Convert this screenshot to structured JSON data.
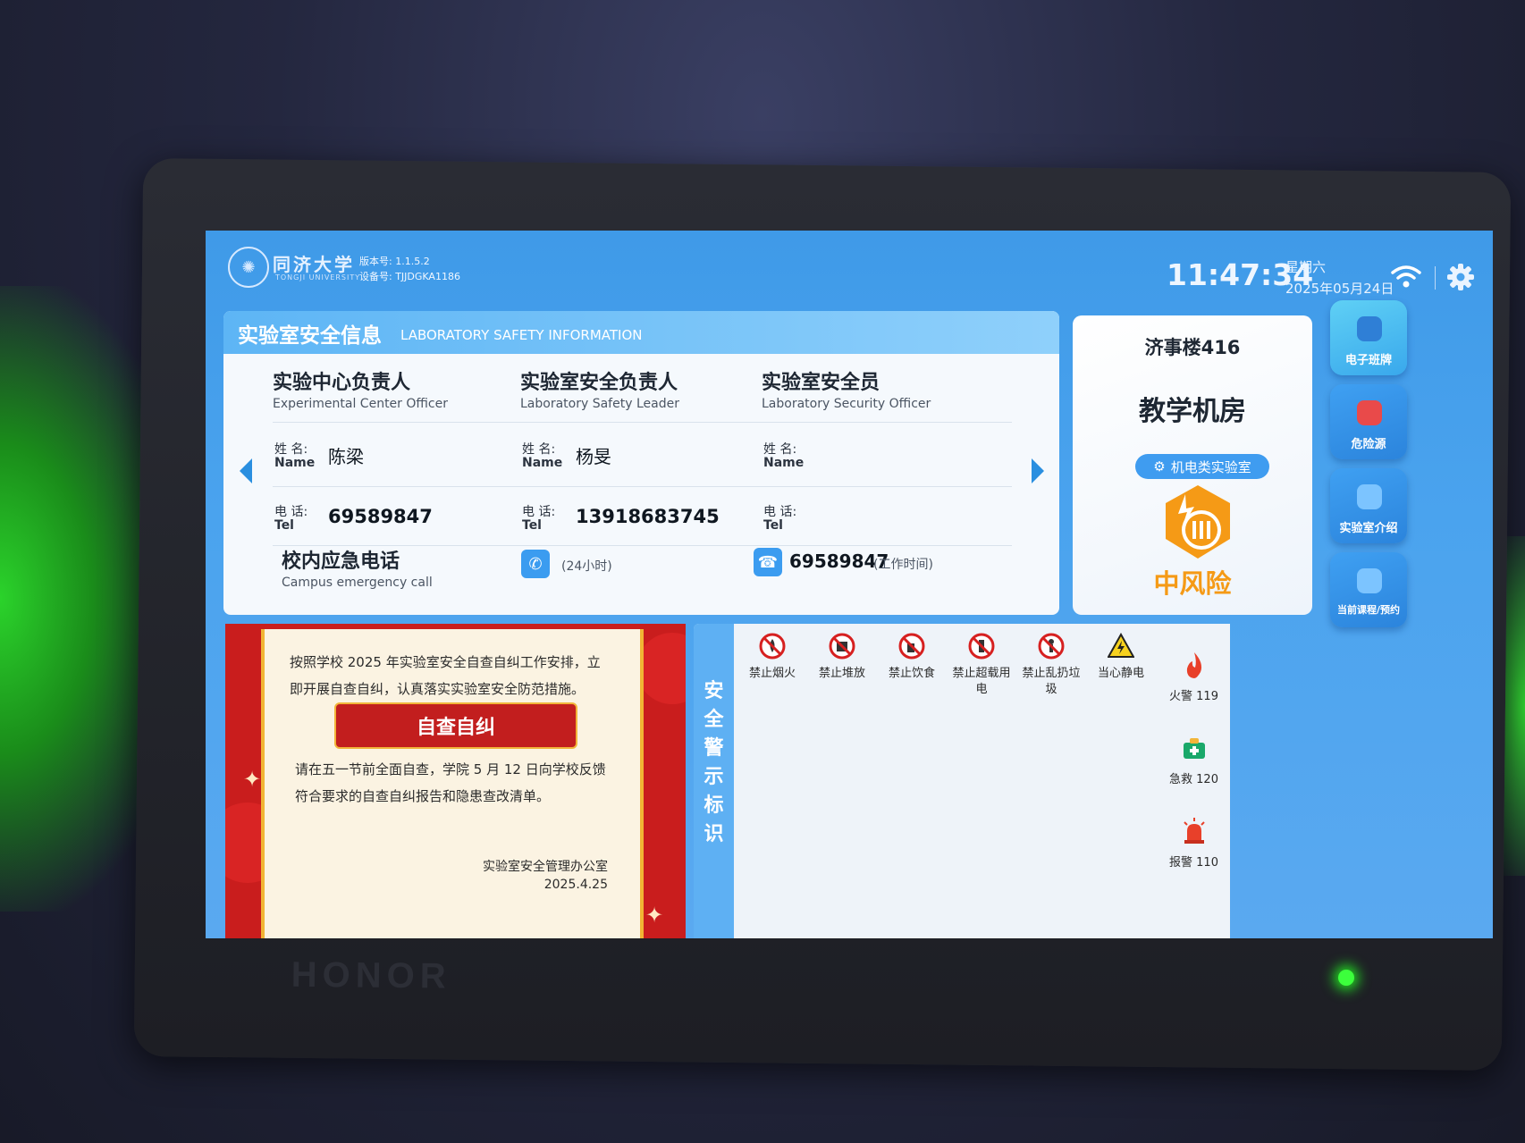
{
  "header": {
    "university_name": "同济大学",
    "university_sub": "TONGJI UNIVERSITY",
    "version_label": "版本号: 1.1.5.2",
    "device_label": "设备号: TJJDGKA1186",
    "time": "11:47:34",
    "weekday": "星期六",
    "date": "2025年05月24日"
  },
  "safety_info": {
    "title_cn": "实验室安全信息",
    "title_en": "LABORATORY SAFETY INFORMATION",
    "name_label_cn": "姓 名:",
    "name_label_en": "Name",
    "tel_label_cn": "电 话:",
    "tel_label_en": "Tel",
    "officers": [
      {
        "role_cn": "实验中心负责人",
        "role_en": "Experimental Center Officer",
        "name": "陈梁",
        "tel": "69589847"
      },
      {
        "role_cn": "实验室安全负责人",
        "role_en": "Laboratory Safety Leader",
        "name": "杨旻",
        "tel": "13918683745"
      },
      {
        "role_cn": "实验室安全员",
        "role_en": "Laboratory Security Officer",
        "name": "",
        "tel": ""
      }
    ],
    "emergency": {
      "title_cn": "校内应急电话",
      "title_en": "Campus emergency call",
      "hours_24": "(24小时)",
      "number": "69589847",
      "work_hours": "(工作时间)"
    }
  },
  "room": {
    "number": "济事楼416",
    "name": "教学机房",
    "category": "机电类实验室",
    "risk_level": "中风险",
    "risk_color": "#f59a16"
  },
  "side_nav": [
    {
      "label": "电子班牌",
      "icon": "monitor-icon"
    },
    {
      "label": "危险源",
      "icon": "warning-icon"
    },
    {
      "label": "实验室介绍",
      "icon": "flask-icon"
    },
    {
      "label": "当前课程/预约",
      "icon": "calendar-icon"
    }
  ],
  "notice": {
    "paragraph1": "按照学校 2025 年实验室安全自查自纠工作安排，立即开展自查自纠，认真落实实验室安全防范措施。",
    "button": "自查自纠",
    "paragraph2": "请在五一节前全面自查，学院 5 月 12 日向学校反馈符合要求的自查自纠报告和隐患查改清单。",
    "signature": "实验室安全管理办公室",
    "sign_date": "2025.4.25"
  },
  "warnings": {
    "title": "安全警示标识",
    "signs": [
      {
        "label": "禁止烟火",
        "icon": "no-fire-icon"
      },
      {
        "label": "禁止堆放",
        "icon": "no-stacking-icon"
      },
      {
        "label": "禁止饮食",
        "icon": "no-food-icon"
      },
      {
        "label": "禁止超载用电",
        "icon": "no-overload-icon"
      },
      {
        "label": "禁止乱扔垃圾",
        "icon": "no-littering-icon"
      },
      {
        "label": "当心静电",
        "icon": "static-warning-icon"
      }
    ],
    "calls": [
      {
        "label": "火警 119",
        "icon": "fire-icon"
      },
      {
        "label": "急救 120",
        "icon": "first-aid-icon"
      },
      {
        "label": "报警 110",
        "icon": "alarm-icon"
      }
    ]
  },
  "bezel_brand": "HONOR"
}
